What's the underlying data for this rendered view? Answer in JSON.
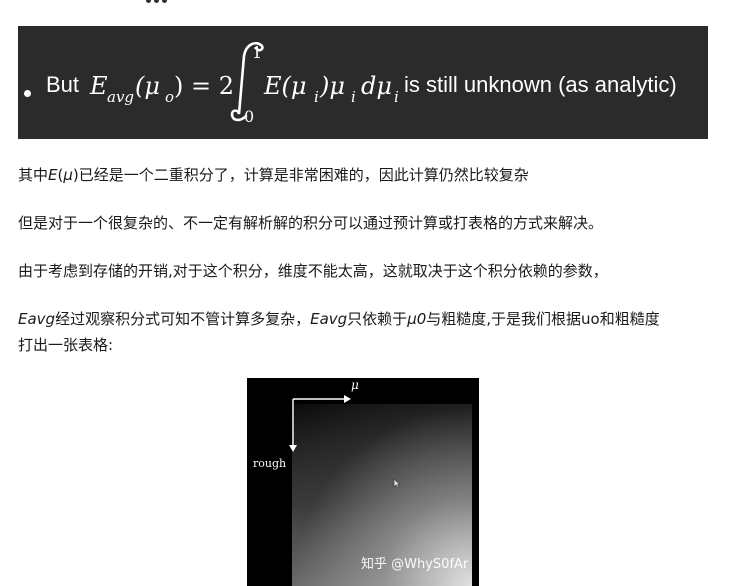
{
  "formula": {
    "prefix": "But",
    "lhs": "E",
    "lhs_sub": "avg",
    "lhs_arg": "(μ",
    "lhs_arg_sub": "o",
    "equals": ") = 2",
    "upper": "1",
    "lower": "0",
    "integrand": "E(μ",
    "integrand_sub1": "i",
    "integrand_mid": ")μ",
    "integrand_sub2": "i",
    "differential": "dμ",
    "differential_sub": "i",
    "suffix": "is still unknown (as analytic)"
  },
  "paragraphs": {
    "p1": {
      "a": "其中",
      "b": "E",
      "c": "(",
      "d": "μ",
      "e": ")已经是一个二重积分了，计算是非常困难的，因此计算仍然比较复杂"
    },
    "p2": "但是对于一个很复杂的、不一定有解析解的积分可以通过预计算或打表格的方式来解决。",
    "p3": "由于考虑到存储的开销,对于这个积分，维度不能太高，这就取决于这个积分依赖的参数，",
    "p4": {
      "a": "Eavg",
      "b": "经过观察积分式可知不管计算多复杂，",
      "c": "Eavg",
      "d": "只依赖于",
      "e": "μ0",
      "f": "与粗糙度,于是我们根据uo和粗糙度"
    },
    "p5": "打出一张表格:"
  },
  "figure": {
    "x_axis_label": "μ",
    "y_axis_label": "rough",
    "watermark": "知乎 @WhyS0fAr"
  },
  "colors": {
    "banner_bg": "#2b2b2b",
    "figure_bg": "#000000",
    "text": "#1a1a1a"
  }
}
